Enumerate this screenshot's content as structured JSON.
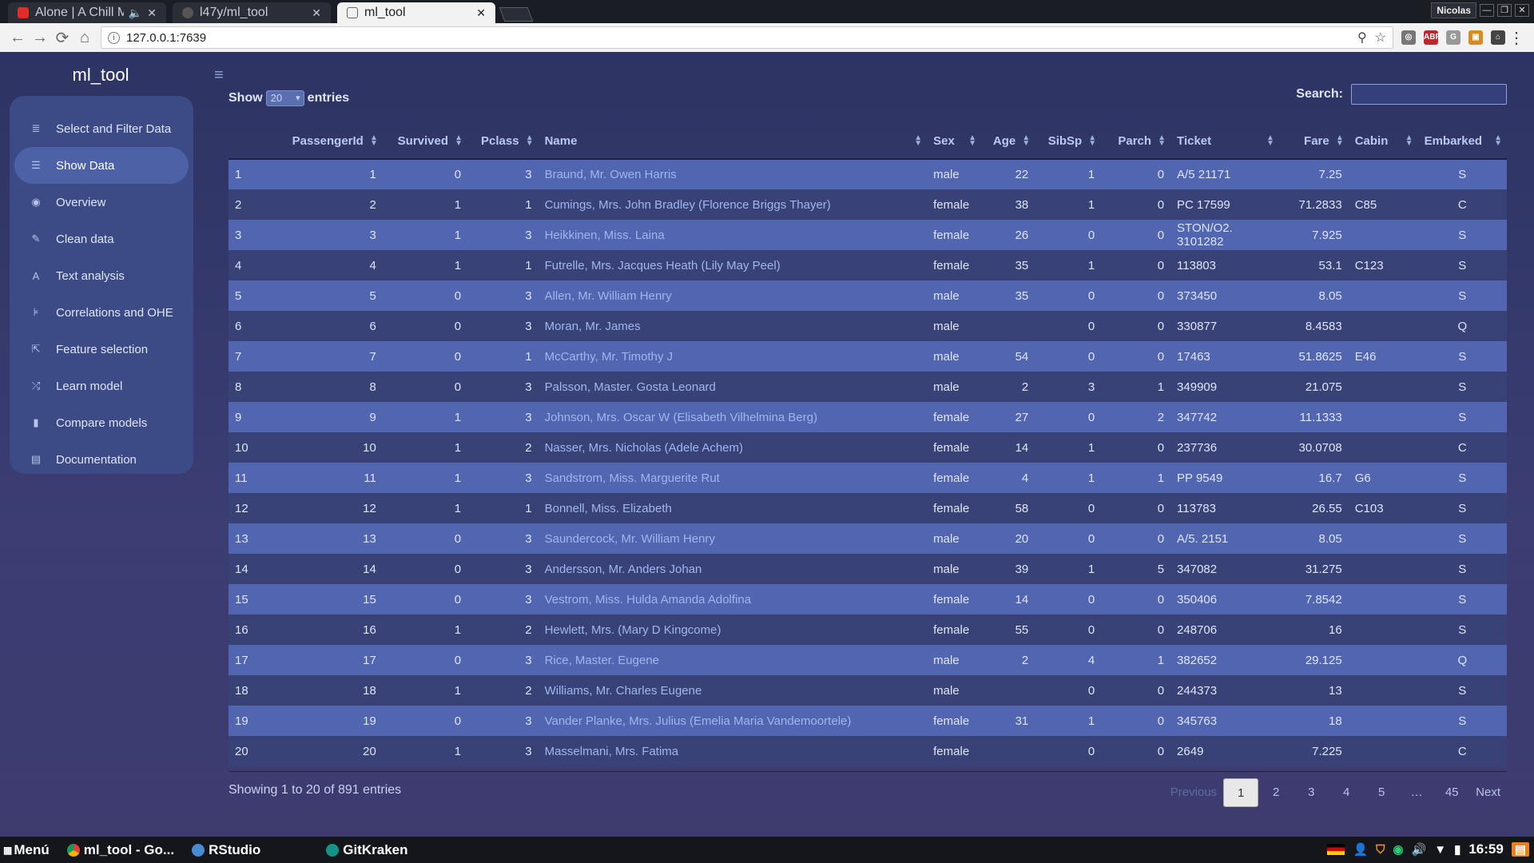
{
  "browser": {
    "tabs": [
      {
        "title": "Alone | A Chill M",
        "active": false
      },
      {
        "title": "l47y/ml_tool",
        "active": false
      },
      {
        "title": "ml_tool",
        "active": true
      }
    ],
    "profile": "Nicolas",
    "url": "127.0.0.1:7639"
  },
  "app": {
    "brand": "ml_tool",
    "sidebar": [
      {
        "label": "Select and Filter Data",
        "icon": "database-icon",
        "active": false
      },
      {
        "label": "Show Data",
        "icon": "list-icon",
        "active": true
      },
      {
        "label": "Overview",
        "icon": "eye-icon",
        "active": false
      },
      {
        "label": "Clean data",
        "icon": "wrench-icon",
        "active": false
      },
      {
        "label": "Text analysis",
        "icon": "font-icon",
        "active": false
      },
      {
        "label": "Correlations and OHE",
        "icon": "sliders-icon",
        "active": false
      },
      {
        "label": "Feature selection",
        "icon": "external-link-icon",
        "active": false
      },
      {
        "label": "Learn model",
        "icon": "random-icon",
        "active": false
      },
      {
        "label": "Compare models",
        "icon": "bar-chart-icon",
        "active": false
      },
      {
        "label": "Documentation",
        "icon": "document-icon",
        "active": false
      }
    ],
    "show_label": "Show",
    "entries_value": "20",
    "entries_label": "entries",
    "search_label": "Search:",
    "search_value": "",
    "columns": [
      "",
      "PassengerId",
      "Survived",
      "Pclass",
      "Name",
      "Sex",
      "Age",
      "SibSp",
      "Parch",
      "Ticket",
      "Fare",
      "Cabin",
      "Embarked"
    ],
    "rows": [
      [
        "1",
        "1",
        "0",
        "3",
        "Braund, Mr. Owen Harris",
        "male",
        "22",
        "1",
        "0",
        "A/5 21171",
        "7.25",
        "",
        "S"
      ],
      [
        "2",
        "2",
        "1",
        "1",
        "Cumings, Mrs. John Bradley (Florence Briggs Thayer)",
        "female",
        "38",
        "1",
        "0",
        "PC 17599",
        "71.2833",
        "C85",
        "C"
      ],
      [
        "3",
        "3",
        "1",
        "3",
        "Heikkinen, Miss. Laina",
        "female",
        "26",
        "0",
        "0",
        "STON/O2. 3101282",
        "7.925",
        "",
        "S"
      ],
      [
        "4",
        "4",
        "1",
        "1",
        "Futrelle, Mrs. Jacques Heath (Lily May Peel)",
        "female",
        "35",
        "1",
        "0",
        "113803",
        "53.1",
        "C123",
        "S"
      ],
      [
        "5",
        "5",
        "0",
        "3",
        "Allen, Mr. William Henry",
        "male",
        "35",
        "0",
        "0",
        "373450",
        "8.05",
        "",
        "S"
      ],
      [
        "6",
        "6",
        "0",
        "3",
        "Moran, Mr. James",
        "male",
        "",
        "0",
        "0",
        "330877",
        "8.4583",
        "",
        "Q"
      ],
      [
        "7",
        "7",
        "0",
        "1",
        "McCarthy, Mr. Timothy J",
        "male",
        "54",
        "0",
        "0",
        "17463",
        "51.8625",
        "E46",
        "S"
      ],
      [
        "8",
        "8",
        "0",
        "3",
        "Palsson, Master. Gosta Leonard",
        "male",
        "2",
        "3",
        "1",
        "349909",
        "21.075",
        "",
        "S"
      ],
      [
        "9",
        "9",
        "1",
        "3",
        "Johnson, Mrs. Oscar W (Elisabeth Vilhelmina Berg)",
        "female",
        "27",
        "0",
        "2",
        "347742",
        "11.1333",
        "",
        "S"
      ],
      [
        "10",
        "10",
        "1",
        "2",
        "Nasser, Mrs. Nicholas (Adele Achem)",
        "female",
        "14",
        "1",
        "0",
        "237736",
        "30.0708",
        "",
        "C"
      ],
      [
        "11",
        "11",
        "1",
        "3",
        "Sandstrom, Miss. Marguerite Rut",
        "female",
        "4",
        "1",
        "1",
        "PP 9549",
        "16.7",
        "G6",
        "S"
      ],
      [
        "12",
        "12",
        "1",
        "1",
        "Bonnell, Miss. Elizabeth",
        "female",
        "58",
        "0",
        "0",
        "113783",
        "26.55",
        "C103",
        "S"
      ],
      [
        "13",
        "13",
        "0",
        "3",
        "Saundercock, Mr. William Henry",
        "male",
        "20",
        "0",
        "0",
        "A/5. 2151",
        "8.05",
        "",
        "S"
      ],
      [
        "14",
        "14",
        "0",
        "3",
        "Andersson, Mr. Anders Johan",
        "male",
        "39",
        "1",
        "5",
        "347082",
        "31.275",
        "",
        "S"
      ],
      [
        "15",
        "15",
        "0",
        "3",
        "Vestrom, Miss. Hulda Amanda Adolfina",
        "female",
        "14",
        "0",
        "0",
        "350406",
        "7.8542",
        "",
        "S"
      ],
      [
        "16",
        "16",
        "1",
        "2",
        "Hewlett, Mrs. (Mary D Kingcome)",
        "female",
        "55",
        "0",
        "0",
        "248706",
        "16",
        "",
        "S"
      ],
      [
        "17",
        "17",
        "0",
        "3",
        "Rice, Master. Eugene",
        "male",
        "2",
        "4",
        "1",
        "382652",
        "29.125",
        "",
        "Q"
      ],
      [
        "18",
        "18",
        "1",
        "2",
        "Williams, Mr. Charles Eugene",
        "male",
        "",
        "0",
        "0",
        "244373",
        "13",
        "",
        "S"
      ],
      [
        "19",
        "19",
        "0",
        "3",
        "Vander Planke, Mrs. Julius (Emelia Maria Vandemoortele)",
        "female",
        "31",
        "1",
        "0",
        "345763",
        "18",
        "",
        "S"
      ],
      [
        "20",
        "20",
        "1",
        "3",
        "Masselmani, Mrs. Fatima",
        "female",
        "",
        "0",
        "0",
        "2649",
        "7.225",
        "",
        "C"
      ]
    ],
    "info": "Showing 1 to 20 of 891 entries",
    "pagination": [
      "Previous",
      "1",
      "2",
      "3",
      "4",
      "5",
      "…",
      "45",
      "Next"
    ],
    "current_page": "1"
  },
  "taskbar": {
    "menu": "Menú",
    "items": [
      "ml_tool - Go...",
      "RStudio",
      "GitKraken"
    ],
    "clock": "16:59"
  },
  "colors": {
    "row_odd": "#5165b0",
    "row_even": "#394277",
    "sidebar": "#3c4a86",
    "active_item": "#4d62a6"
  }
}
